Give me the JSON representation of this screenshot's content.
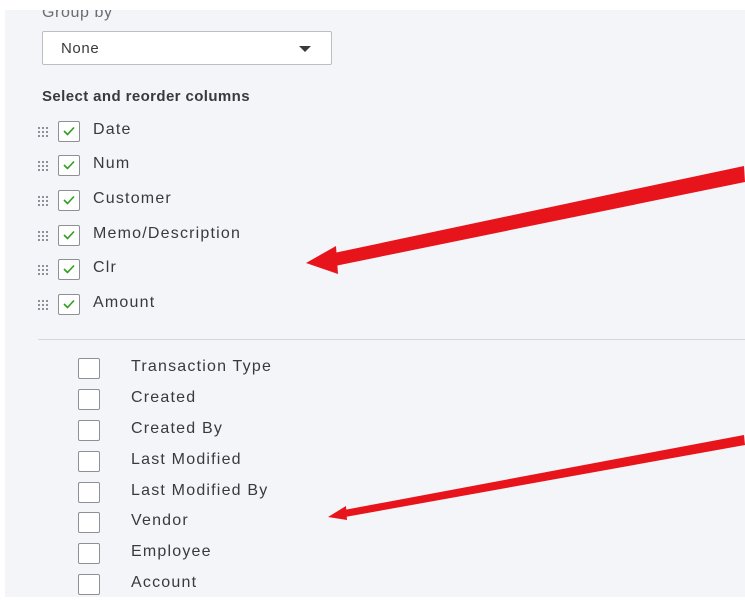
{
  "group_by": {
    "label": "Group by",
    "selected": "None"
  },
  "columns_section": {
    "title": "Select and reorder columns",
    "selected_columns": [
      {
        "label": "Date",
        "checked": true
      },
      {
        "label": "Num",
        "checked": true
      },
      {
        "label": "Customer",
        "checked": true
      },
      {
        "label": "Memo/Description",
        "checked": true
      },
      {
        "label": "Clr",
        "checked": true
      },
      {
        "label": "Amount",
        "checked": true
      }
    ],
    "available_columns": [
      {
        "label": "Transaction Type",
        "checked": false
      },
      {
        "label": "Created",
        "checked": false
      },
      {
        "label": "Created By",
        "checked": false
      },
      {
        "label": "Last Modified",
        "checked": false
      },
      {
        "label": "Last Modified By",
        "checked": false
      },
      {
        "label": "Vendor",
        "checked": false
      },
      {
        "label": "Employee",
        "checked": false
      },
      {
        "label": "Account",
        "checked": false
      }
    ]
  },
  "colors": {
    "panel_bg": "#f4f5f8",
    "check_green": "#2ca01c",
    "annotation_arrow": "#e8141b"
  },
  "icons": {
    "drag_handle": "drag-handle-icon",
    "checkmark": "checkmark-icon",
    "dropdown": "chevron-down-icon"
  }
}
